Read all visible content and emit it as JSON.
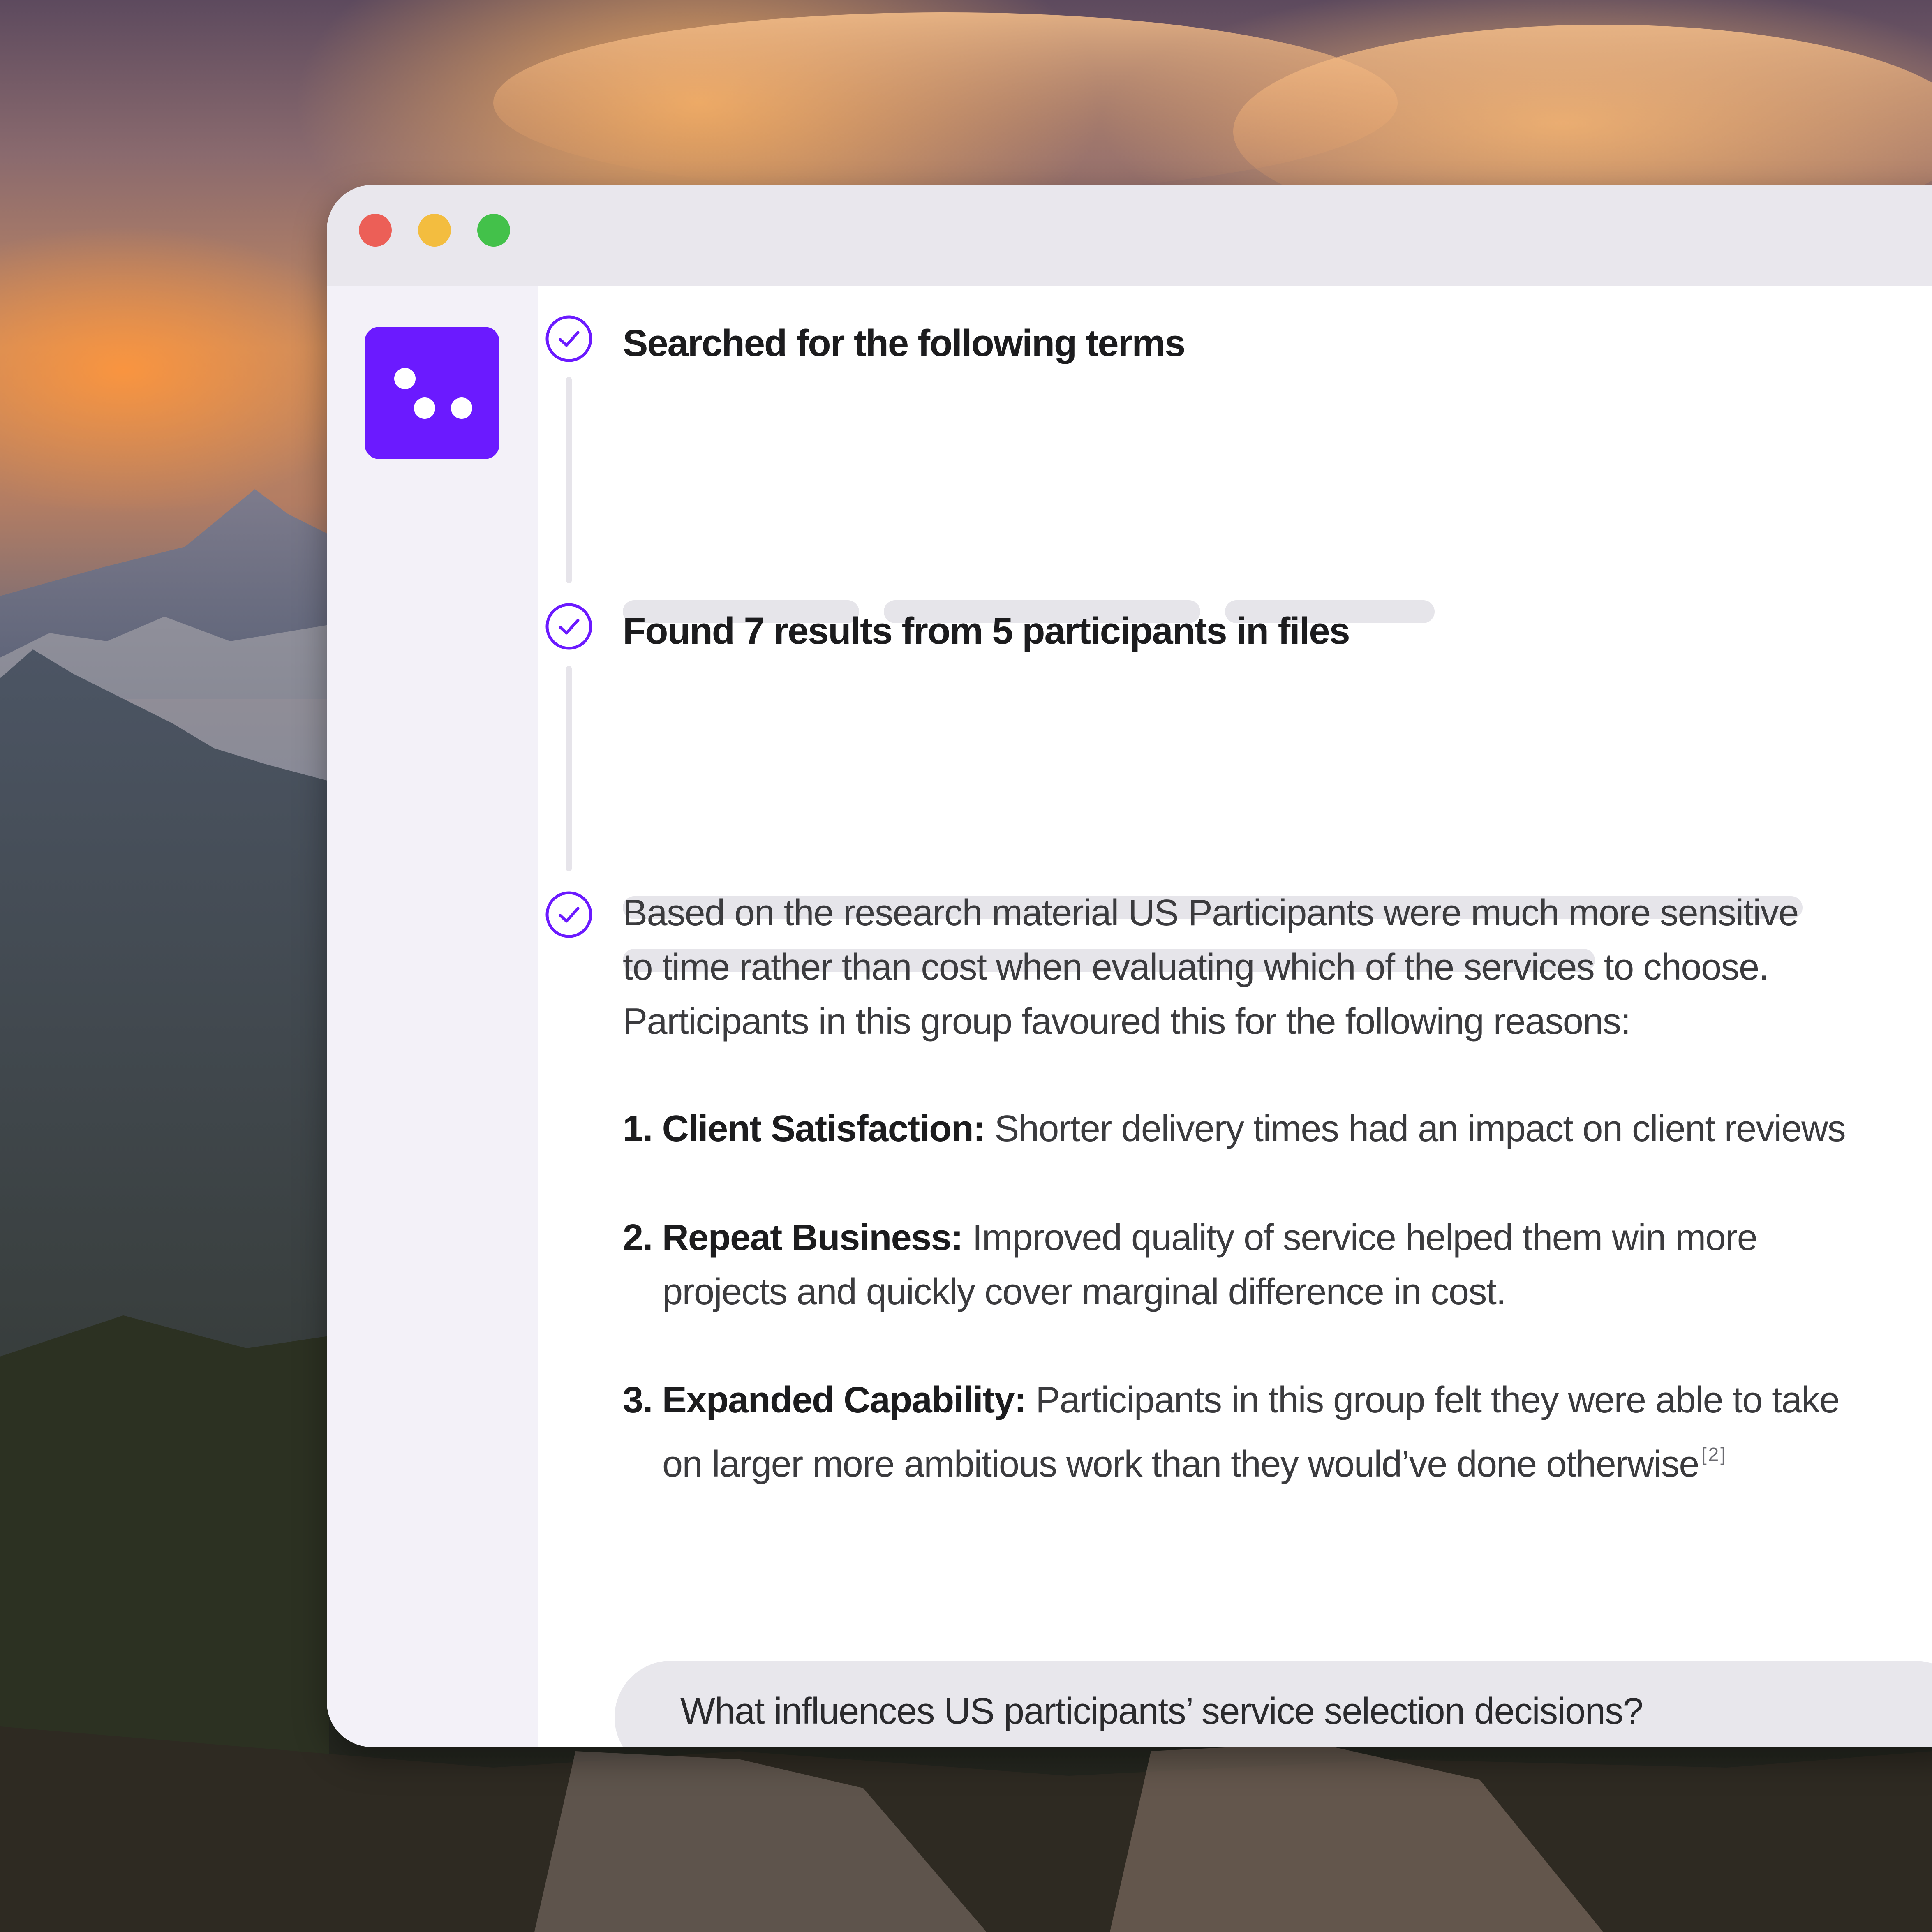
{
  "window": {
    "traffic_lights": {
      "close_color": "#ec5f57",
      "minimize_color": "#f3bd3f",
      "zoom_color": "#43c14a"
    }
  },
  "sidebar": {
    "logo_icon": "three-dots-logo-icon",
    "accent_color": "#6b1aff"
  },
  "steps": [
    {
      "title": "Searched for the following terms",
      "status_icon": "check-circle-icon"
    },
    {
      "title": "Found 7 results from 5 participants in files",
      "status_icon": "check-circle-icon"
    },
    {
      "status_icon": "check-circle-icon",
      "answer": {
        "intro_lines": [
          "Based on the research material US Participants were much more sensitive",
          "to time rather than cost when evaluating which of the services to choose.",
          "Participants in this group favoured this for the following reasons:"
        ],
        "items": [
          {
            "label": "1. Client Satisfaction:",
            "lines": [
              "Shorter delivery times had an impact on client reviews"
            ]
          },
          {
            "label": "2. Repeat Business:",
            "lines": [
              "Improved quality of service helped them win more",
              "projects and quickly cover marginal difference in cost."
            ]
          },
          {
            "label": "3. Expanded Capability:",
            "lines": [
              "Participants in this group felt they were able to take",
              "on larger more ambitious work than they would’ve done otherwise"
            ],
            "citation": "[2]"
          }
        ]
      }
    }
  ],
  "prompt": {
    "text": "What influences US participants’ service selection decisions?"
  }
}
